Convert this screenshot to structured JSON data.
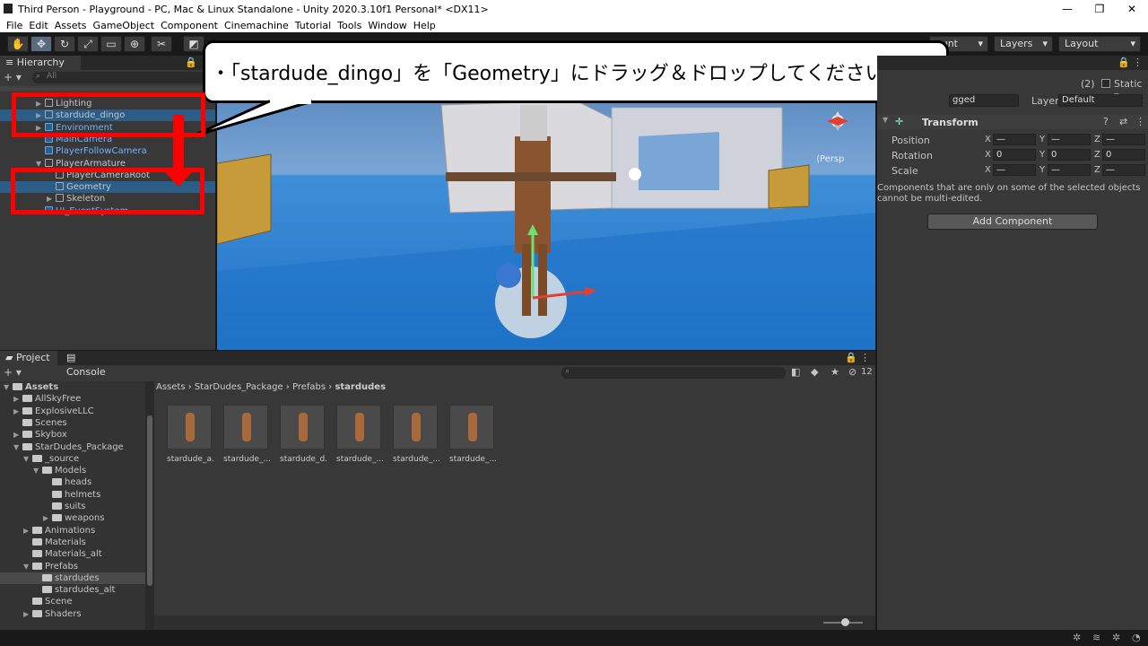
{
  "window": {
    "title": "Third Person - Playground - PC, Mac & Linux Standalone - Unity 2020.3.10f1 Personal* <DX11>",
    "minimize": "—",
    "maximize": "❐",
    "close": "✕"
  },
  "menu": [
    "File",
    "Edit",
    "Assets",
    "GameObject",
    "Component",
    "Cinemachine",
    "Tutorial",
    "Tools",
    "Window",
    "Help"
  ],
  "toolbar": {
    "account_label": "ount",
    "layers_label": "Layers",
    "layout_label": "Layout"
  },
  "hierarchy": {
    "tab": "Hierarchy",
    "search_placeholder": "All",
    "add": "+ ▾",
    "items": [
      {
        "label": "Lighting",
        "indent": 1,
        "arrow": "▶",
        "sel": false
      },
      {
        "label": "stardude_dingo",
        "indent": 1,
        "arrow": "▶",
        "sel": true
      },
      {
        "label": "Environment",
        "indent": 1,
        "arrow": "▶",
        "sel": false,
        "blue": true
      },
      {
        "label": "MainCamera",
        "indent": 1,
        "arrow": "",
        "sel": false,
        "blue": true
      },
      {
        "label": "PlayerFollowCamera",
        "indent": 1,
        "arrow": "",
        "sel": false,
        "blue": true
      },
      {
        "label": "PlayerArmature",
        "indent": 1,
        "arrow": "▼",
        "sel": false
      },
      {
        "label": "PlayerCameraRoot",
        "indent": 2,
        "arrow": "",
        "sel": false
      },
      {
        "label": "Geometry",
        "indent": 2,
        "arrow": "",
        "sel": true
      },
      {
        "label": "Skeleton",
        "indent": 2,
        "arrow": "▶",
        "sel": false
      },
      {
        "label": "UI_EventSystem",
        "indent": 1,
        "arrow": "",
        "sel": false,
        "blue": true
      }
    ]
  },
  "callout": {
    "text": "・「stardude_dingo」を「Geometry」にドラッグ＆ドロップしてください"
  },
  "scene": {
    "persp_label": "⟨Persp"
  },
  "inspector": {
    "count": "(2)",
    "static_label": "Static ▾",
    "tag_value": "gged",
    "layer_label": "Layer",
    "layer_value": "Default",
    "transform_title": "Transform",
    "rows": [
      {
        "label": "Position",
        "x": "—",
        "y": "—",
        "z": "—"
      },
      {
        "label": "Rotation",
        "x": "0",
        "y": "0",
        "z": "0"
      },
      {
        "label": "Scale",
        "x": "—",
        "y": "—",
        "z": "—"
      }
    ],
    "axis_x": "X",
    "axis_y": "Y",
    "axis_z": "Z",
    "note": "Components that are only on some of the selected objects cannot be multi-edited.",
    "add_component": "Add Component"
  },
  "project": {
    "tab_project": "Project",
    "tab_console": "Console",
    "add": "+ ▾",
    "hidden_count": "12",
    "breadcrumb": [
      "Assets",
      "StarDudes_Package",
      "Prefabs",
      "stardudes"
    ],
    "tree": [
      {
        "label": "Assets",
        "indent": 0,
        "arrow": "▼",
        "bold": true
      },
      {
        "label": "AllSkyFree",
        "indent": 1,
        "arrow": "▶"
      },
      {
        "label": "ExplosiveLLC",
        "indent": 1,
        "arrow": "▶"
      },
      {
        "label": "Scenes",
        "indent": 1,
        "arrow": ""
      },
      {
        "label": "Skybox",
        "indent": 1,
        "arrow": "▶"
      },
      {
        "label": "StarDudes_Package",
        "indent": 1,
        "arrow": "▼"
      },
      {
        "label": "_source",
        "indent": 2,
        "arrow": "▼"
      },
      {
        "label": "Models",
        "indent": 3,
        "arrow": "▼"
      },
      {
        "label": "heads",
        "indent": 4,
        "arrow": ""
      },
      {
        "label": "helmets",
        "indent": 4,
        "arrow": ""
      },
      {
        "label": "suits",
        "indent": 4,
        "arrow": ""
      },
      {
        "label": "weapons",
        "indent": 4,
        "arrow": "▶"
      },
      {
        "label": "Animations",
        "indent": 2,
        "arrow": "▶"
      },
      {
        "label": "Materials",
        "indent": 2,
        "arrow": ""
      },
      {
        "label": "Materials_alt",
        "indent": 2,
        "arrow": ""
      },
      {
        "label": "Prefabs",
        "indent": 2,
        "arrow": "▼"
      },
      {
        "label": "stardudes",
        "indent": 3,
        "arrow": "",
        "sel": true
      },
      {
        "label": "stardudes_alt",
        "indent": 3,
        "arrow": ""
      },
      {
        "label": "Scene",
        "indent": 2,
        "arrow": ""
      },
      {
        "label": "Shaders",
        "indent": 2,
        "arrow": "▶"
      }
    ],
    "assets": [
      "stardude_a...",
      "stardude_...",
      "stardude_d...",
      "stardude_...",
      "stardude_...",
      "stardude_..."
    ]
  }
}
